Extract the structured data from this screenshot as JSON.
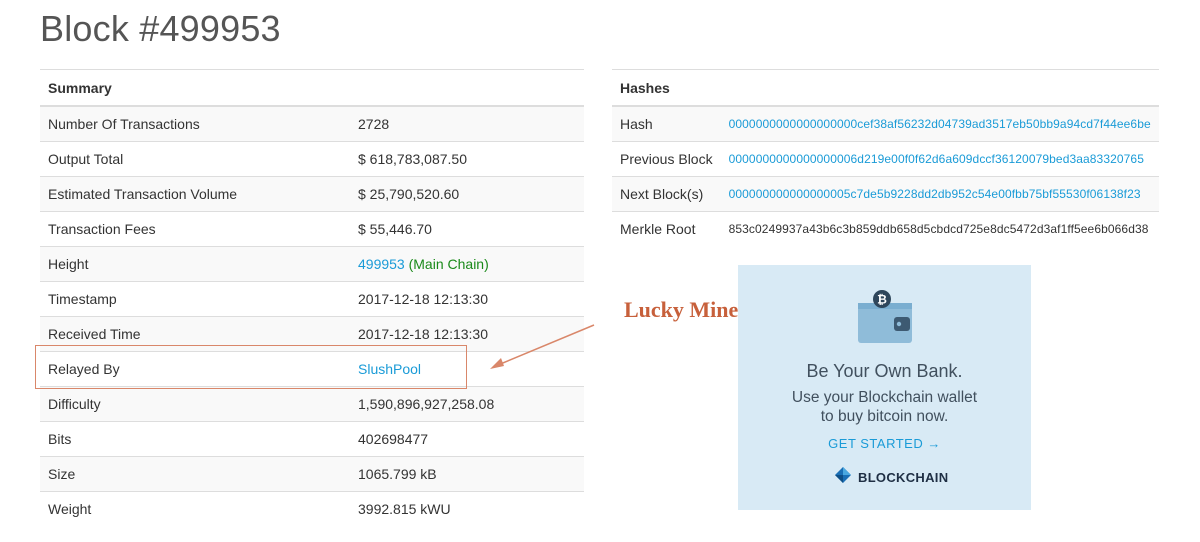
{
  "page": {
    "title": "Block #499953"
  },
  "summary": {
    "header": "Summary",
    "rows": [
      {
        "label": "Number Of Transactions",
        "value": "2728"
      },
      {
        "label": "Output Total",
        "value": "$ 618,783,087.50"
      },
      {
        "label": "Estimated Transaction Volume",
        "value": "$ 25,790,520.60"
      },
      {
        "label": "Transaction Fees",
        "value": "$ 55,446.70"
      },
      {
        "label": "Height",
        "value": "499953",
        "suffix": "(Main Chain)"
      },
      {
        "label": "Timestamp",
        "value": "2017-12-18 12:13:30"
      },
      {
        "label": "Received Time",
        "value": "2017-12-18 12:13:30"
      },
      {
        "label": "Relayed By",
        "value": "SlushPool"
      },
      {
        "label": "Difficulty",
        "value": "1,590,896,927,258.08"
      },
      {
        "label": "Bits",
        "value": "402698477"
      },
      {
        "label": "Size",
        "value": "1065.799 kB"
      },
      {
        "label": "Weight",
        "value": "3992.815 kWU"
      }
    ]
  },
  "hashes": {
    "header": "Hashes",
    "rows": [
      {
        "label": "Hash",
        "value": "0000000000000000000cef38af56232d04739ad3517eb50bb9a94cd7f44ee6be"
      },
      {
        "label": "Previous Block",
        "value": "0000000000000000006d219e00f0f62d6a609dccf36120079bed3aa83320765"
      },
      {
        "label": "Next Block(s)",
        "value": "000000000000000005c7de5b9228dd2db952c54e00fbb75bf55530f06138f23"
      },
      {
        "label": "Merkle Root",
        "value": "853c0249937a43b6c3b859ddb658d5cbdcd725e8dc5472d3af1ff5ee6b066d38"
      }
    ]
  },
  "annotation": {
    "label": "Lucky Miner",
    "color": "#c7603b"
  },
  "ad": {
    "title": "Be Your Own Bank.",
    "line1": "Use your Blockchain wallet",
    "line2": "to buy bitcoin now.",
    "cta": "GET STARTED →",
    "brand": "BLOCKCHAIN",
    "wallet_icon": "wallet-bitcoin-icon",
    "brand_icon": "blockchain-logo-icon",
    "bg_color": "#d8eaf5"
  },
  "colors": {
    "link": "#1a9bd7",
    "main_chain": "#1a8a1a",
    "title": "#555555"
  }
}
